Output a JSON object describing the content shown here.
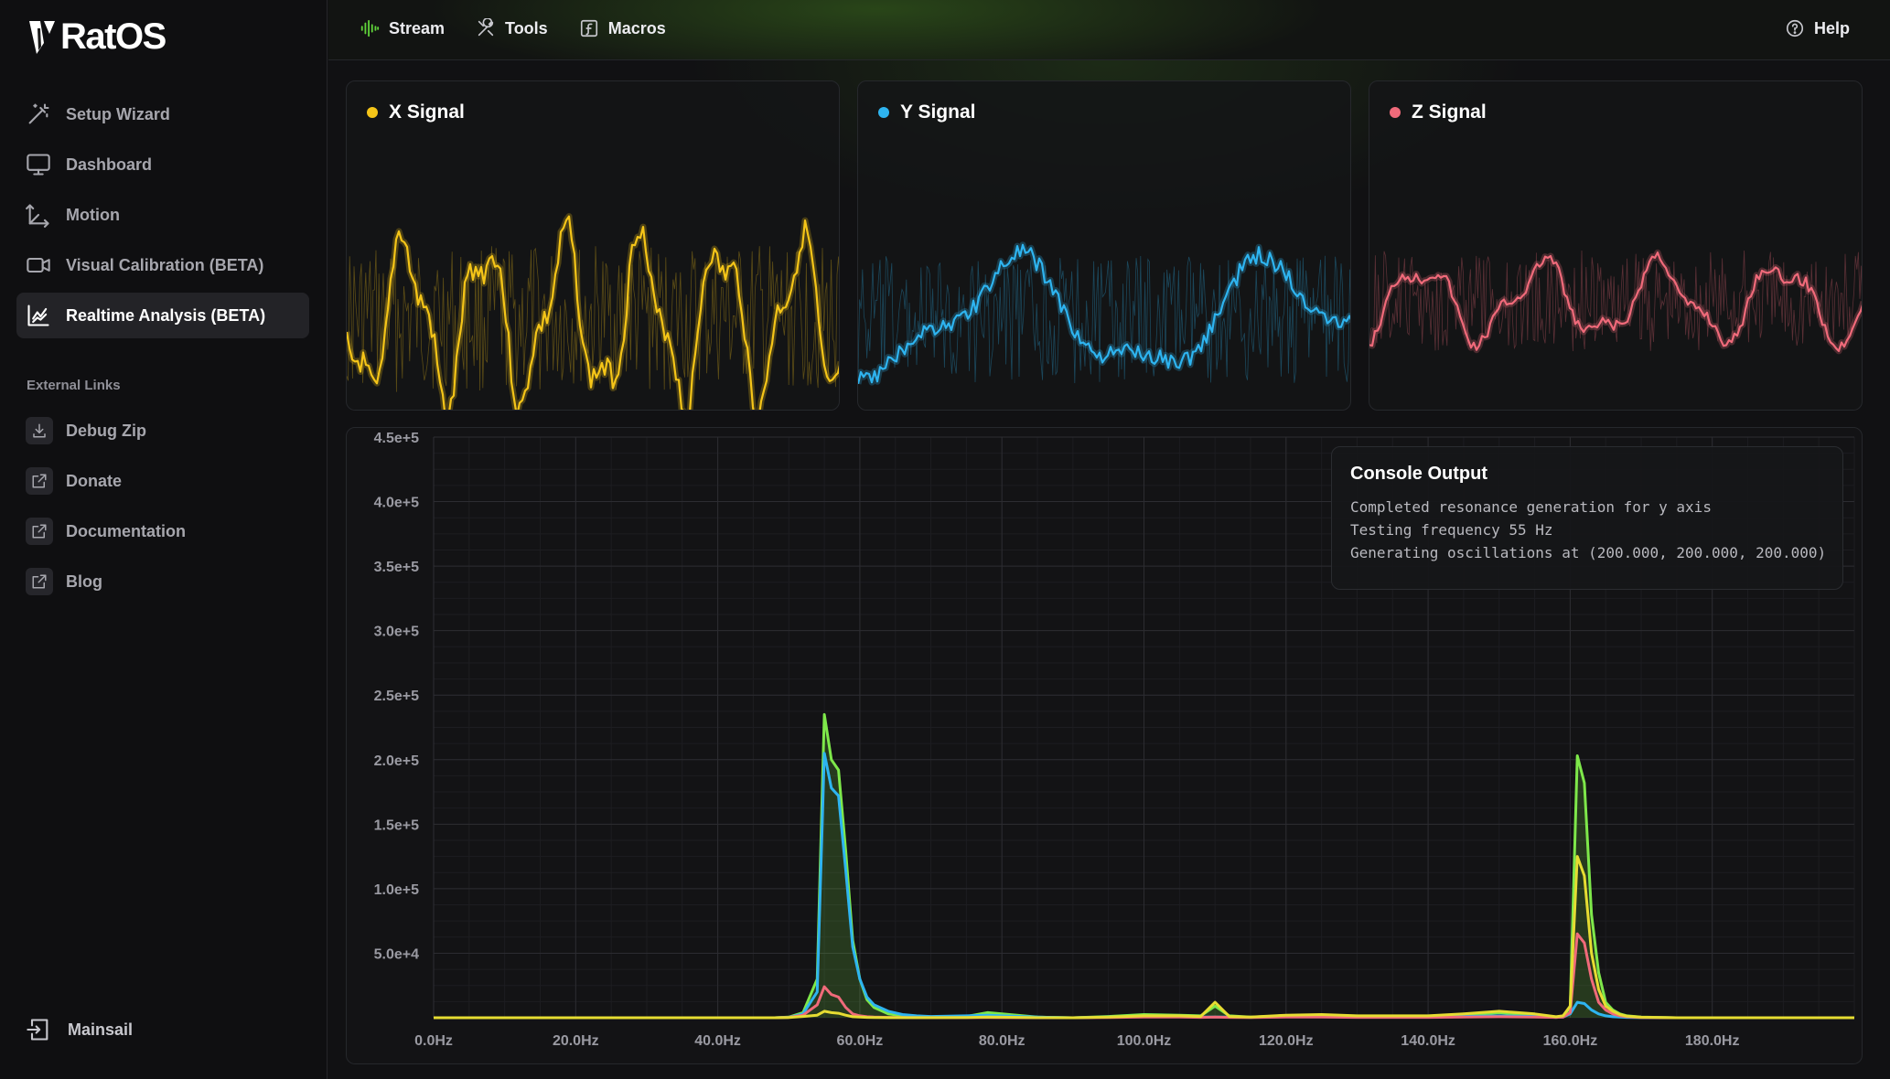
{
  "app": {
    "name": "RatOS"
  },
  "nav": {
    "items": [
      {
        "label": "Setup Wizard",
        "icon": "magic-wand-icon",
        "active": false
      },
      {
        "label": "Dashboard",
        "icon": "monitor-icon",
        "active": false
      },
      {
        "label": "Motion",
        "icon": "axis-icon",
        "active": false
      },
      {
        "label": "Visual Calibration (BETA)",
        "icon": "camera-icon",
        "active": false
      },
      {
        "label": "Realtime Analysis (BETA)",
        "icon": "chart-icon",
        "active": true
      }
    ]
  },
  "external": {
    "section_label": "External Links",
    "items": [
      {
        "label": "Debug Zip",
        "icon": "download-icon"
      },
      {
        "label": "Donate",
        "icon": "external-link-icon"
      },
      {
        "label": "Documentation",
        "icon": "external-link-icon"
      },
      {
        "label": "Blog",
        "icon": "external-link-icon"
      }
    ]
  },
  "footer": {
    "mainsail_label": "Mainsail"
  },
  "topbar": {
    "tabs": [
      {
        "label": "Stream",
        "icon": "waveform-icon"
      },
      {
        "label": "Tools",
        "icon": "tools-icon"
      },
      {
        "label": "Macros",
        "icon": "function-icon"
      }
    ],
    "help_label": "Help"
  },
  "signals": [
    {
      "label": "X Signal",
      "color": "#f5c518"
    },
    {
      "label": "Y Signal",
      "color": "#2eb4f0"
    },
    {
      "label": "Z Signal",
      "color": "#f06a7a"
    }
  ],
  "console": {
    "title": "Console Output",
    "lines": [
      "Completed resonance generation for y axis",
      "Testing frequency 55 Hz",
      "Generating oscillations at (200.000, 200.000, 200.000)"
    ]
  },
  "chart_data": {
    "type": "line",
    "title": "",
    "xlabel": "",
    "ylabel": "",
    "xlim": [
      0,
      200
    ],
    "ylim": [
      0,
      450000
    ],
    "x_ticks": [
      "0.0Hz",
      "20.0Hz",
      "40.0Hz",
      "60.0Hz",
      "80.0Hz",
      "100.0Hz",
      "120.0Hz",
      "140.0Hz",
      "160.0Hz",
      "180.0Hz"
    ],
    "x_tick_values": [
      0,
      20,
      40,
      60,
      80,
      100,
      120,
      140,
      160,
      180
    ],
    "y_ticks": [
      "5.0e+4",
      "1.0e+5",
      "1.5e+5",
      "2.0e+5",
      "2.5e+5",
      "3.0e+5",
      "3.5e+5",
      "4.0e+5",
      "4.5e+5"
    ],
    "y_tick_values": [
      50000,
      100000,
      150000,
      200000,
      250000,
      300000,
      350000,
      400000,
      450000
    ],
    "grid": true,
    "x": [
      0,
      40,
      48,
      50,
      52,
      54,
      55,
      56,
      57,
      58,
      59,
      60,
      61,
      62,
      64,
      66,
      68,
      70,
      75,
      78,
      80,
      85,
      90,
      95,
      100,
      105,
      108,
      110,
      112,
      115,
      120,
      125,
      130,
      135,
      140,
      145,
      150,
      155,
      158,
      159,
      160,
      161,
      162,
      163,
      164,
      165,
      166,
      167,
      168,
      170,
      175,
      180,
      200
    ],
    "series": [
      {
        "name": "",
        "color": "#7ee84a",
        "fill": true,
        "values": [
          0,
          0,
          0,
          500,
          4000,
          30000,
          235000,
          200000,
          192000,
          130000,
          60000,
          30000,
          14000,
          8000,
          3000,
          1500,
          1000,
          500,
          1000,
          4000,
          3000,
          500,
          0,
          1000,
          2500,
          2000,
          1500,
          9000,
          1500,
          500,
          1500,
          2000,
          1000,
          1000,
          1000,
          2000,
          4000,
          2000,
          500,
          1000,
          8000,
          203000,
          182000,
          80000,
          35000,
          12000,
          6000,
          3000,
          1500,
          500,
          0,
          0,
          0
        ]
      },
      {
        "name": "",
        "color": "#2eb4f0",
        "fill": false,
        "values": [
          0,
          0,
          0,
          300,
          3000,
          20000,
          205000,
          178000,
          172000,
          115000,
          55000,
          30000,
          16000,
          10000,
          5000,
          2500,
          1500,
          1000,
          1500,
          2000,
          1500,
          500,
          0,
          500,
          1000,
          1000,
          500,
          500,
          500,
          300,
          1000,
          1000,
          500,
          500,
          500,
          1000,
          1500,
          1000,
          300,
          500,
          3000,
          12000,
          11000,
          6000,
          3000,
          1500,
          800,
          500,
          300,
          100,
          0,
          0,
          0
        ]
      },
      {
        "name": "",
        "color": "#f06a7a",
        "fill": false,
        "values": [
          0,
          0,
          0,
          300,
          2000,
          10000,
          24000,
          18000,
          16000,
          8000,
          3000,
          1500,
          800,
          500,
          300,
          200,
          100,
          100,
          100,
          200,
          100,
          0,
          0,
          200,
          500,
          500,
          300,
          500,
          300,
          200,
          500,
          500,
          300,
          300,
          300,
          500,
          800,
          500,
          300,
          500,
          4000,
          65000,
          58000,
          30000,
          12000,
          6000,
          3000,
          1500,
          800,
          200,
          0,
          0,
          0
        ]
      },
      {
        "name": "",
        "color": "#e6dc32",
        "fill": false,
        "values": [
          0,
          0,
          0,
          200,
          1000,
          2000,
          5000,
          4000,
          3500,
          2000,
          800,
          500,
          300,
          200,
          100,
          100,
          100,
          100,
          200,
          500,
          400,
          100,
          0,
          500,
          1500,
          1500,
          1000,
          12000,
          1000,
          500,
          2000,
          2500,
          1500,
          1500,
          1500,
          3000,
          5000,
          3000,
          800,
          1500,
          9000,
          125000,
          110000,
          50000,
          22000,
          9000,
          5000,
          2500,
          1200,
          400,
          0,
          0,
          0
        ]
      }
    ]
  }
}
